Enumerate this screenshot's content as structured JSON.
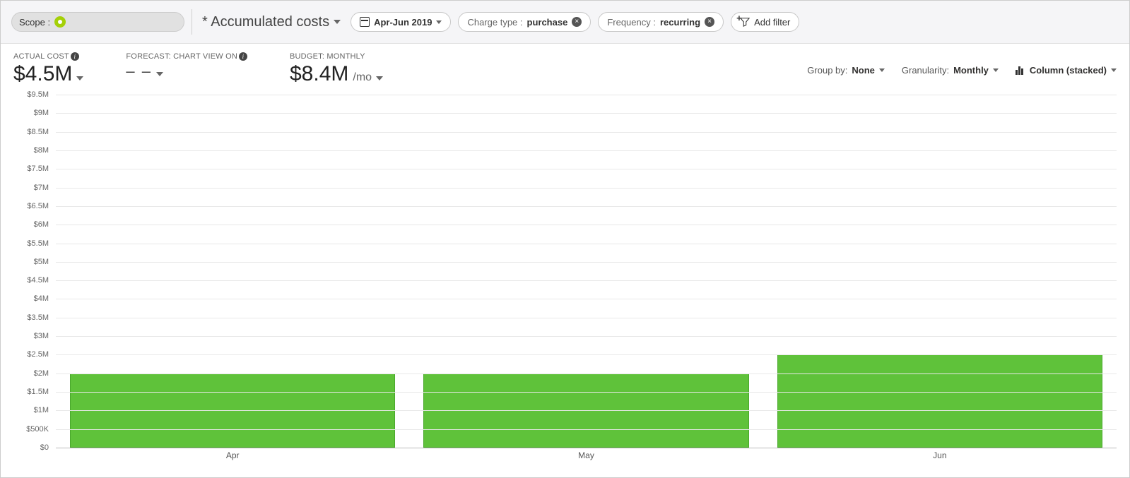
{
  "toolbar": {
    "scope_label": "Scope :",
    "view_name": "* Accumulated costs",
    "date_range": "Apr-Jun 2019",
    "filter_charge_type": {
      "label": "Charge type :",
      "value": "purchase"
    },
    "filter_frequency": {
      "label": "Frequency :",
      "value": "recurring"
    },
    "add_filter": "Add filter"
  },
  "kpis": {
    "actual_cost": {
      "label": "ACTUAL COST",
      "value": "$4.5M"
    },
    "forecast": {
      "label": "FORECAST: CHART VIEW ON",
      "value": "– –"
    },
    "budget": {
      "label": "BUDGET: MONTHLY",
      "value": "$8.4M",
      "suffix": "/mo"
    }
  },
  "controls": {
    "group_by": {
      "label": "Group by:",
      "value": "None"
    },
    "granularity": {
      "label": "Granularity:",
      "value": "Monthly"
    },
    "chart_type": "Column (stacked)"
  },
  "chart_data": {
    "type": "bar",
    "categories": [
      "Apr",
      "May",
      "Jun"
    ],
    "values": [
      2000000,
      2000000,
      2500000
    ],
    "title": "",
    "xlabel": "",
    "ylabel": "",
    "ylim": [
      0,
      9500000
    ],
    "y_ticks": [
      "$0",
      "$500K",
      "$1M",
      "$1.5M",
      "$2M",
      "$2.5M",
      "$3M",
      "$3.5M",
      "$4M",
      "$4.5M",
      "$5M",
      "$5.5M",
      "$6M",
      "$6.5M",
      "$7M",
      "$7.5M",
      "$8M",
      "$8.5M",
      "$9M",
      "$9.5M"
    ],
    "y_tick_values": [
      0,
      500000,
      1000000,
      1500000,
      2000000,
      2500000,
      3000000,
      3500000,
      4000000,
      4500000,
      5000000,
      5500000,
      6000000,
      6500000,
      7000000,
      7500000,
      8000000,
      8500000,
      9000000,
      9500000
    ],
    "bar_color": "#5fc23a"
  }
}
